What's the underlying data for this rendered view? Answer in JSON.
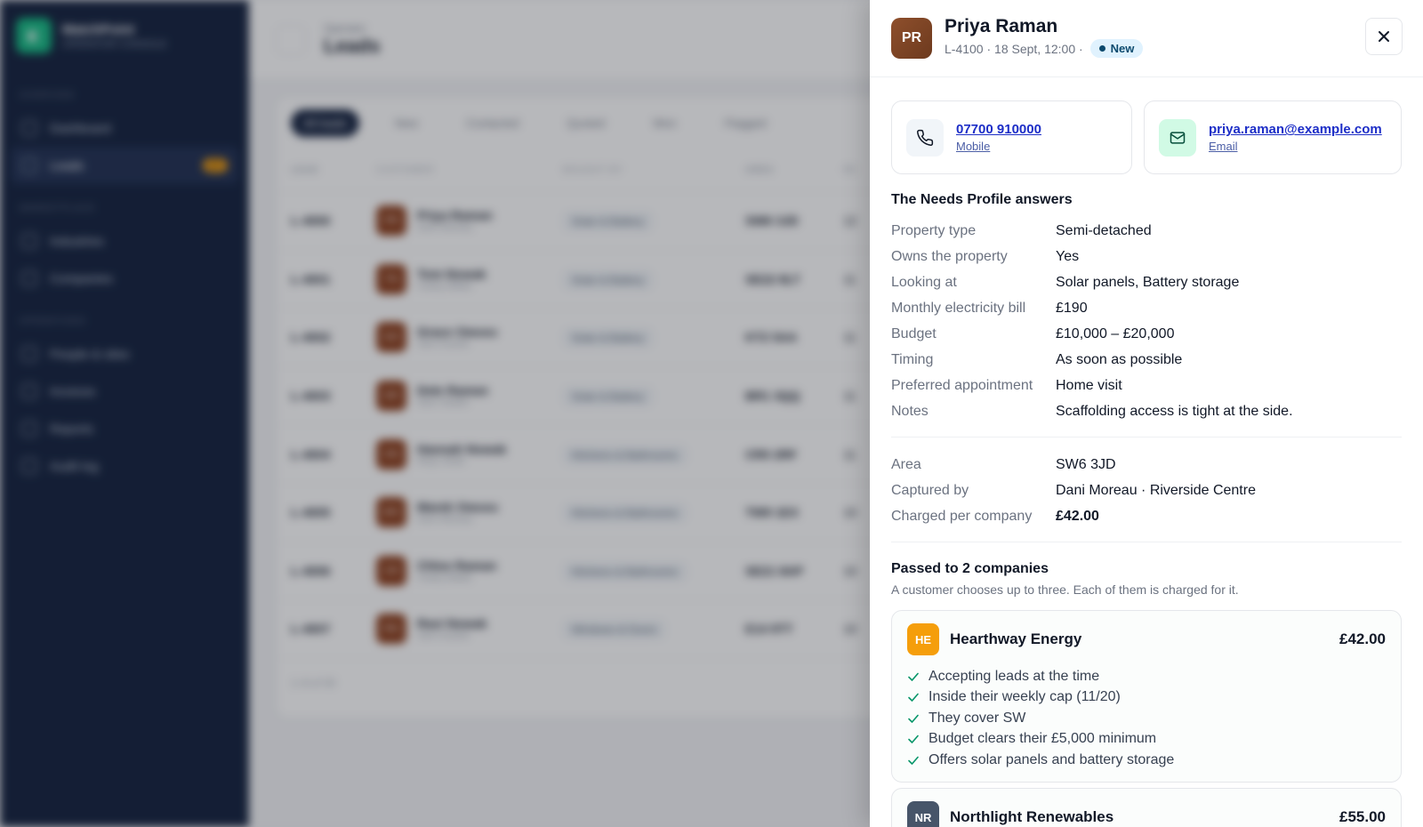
{
  "app": {
    "brand_name": "MatchPoint",
    "brand_sub": "OPERATOR CONSOLE",
    "nav": [
      {
        "section": "OVERVIEW"
      },
      {
        "label": "Dashboard"
      },
      {
        "label": "Leads",
        "badge": "27",
        "active": true
      },
      {
        "section": "MARKETPLACE"
      },
      {
        "label": "Industries"
      },
      {
        "label": "Companies"
      },
      {
        "section": "OPERATIONS"
      },
      {
        "label": "People & sites"
      },
      {
        "label": "Invoices"
      },
      {
        "label": "Reports"
      },
      {
        "label": "Audit log"
      }
    ],
    "breadcrumb": "Operator",
    "page_title": "Leads",
    "filters": [
      "All leads",
      "New",
      "Contacted",
      "Quoted",
      "Won",
      "Flagged"
    ],
    "table_headers": [
      "LEAD",
      "CUSTOMER",
      "BOUGHT BY",
      "AREA",
      "RE"
    ],
    "rows": [
      {
        "id": "L-4000",
        "initials": "PR",
        "name": "Priya Raman",
        "sub": "Dani Moreau",
        "tag": "Solar & Battery",
        "area": "SW6 3JD",
        "extra": "12"
      },
      {
        "id": "L-4001",
        "initials": "TN",
        "name": "Tom Nowak",
        "sub": "Casey Blake",
        "tag": "Solar & Battery",
        "area": "SE22 8LT",
        "extra": "11"
      },
      {
        "id": "L-4002",
        "initials": "GO",
        "name": "Grace Owusu",
        "sub": "Sam Duarte",
        "tag": "Solar & Battery",
        "area": "KT2 5AA",
        "extra": "11"
      },
      {
        "id": "L-4003",
        "initials": "DR",
        "name": "Dele Raman",
        "sub": "Sam Okafor",
        "tag": "Solar & Battery",
        "area": "BR1 3QQ",
        "extra": "11"
      },
      {
        "id": "L-4004",
        "initials": "HN",
        "name": "Hannah Nowak",
        "sub": "Rhys Shah",
        "tag": "Kitchens & Bathrooms",
        "area": "CR0 2RF",
        "extra": "11"
      },
      {
        "id": "L-4005",
        "initials": "MO",
        "name": "Marek Owusu",
        "sub": "Dani Moreau",
        "tag": "Kitchens & Bathrooms",
        "area": "TW9 1EX",
        "extra": "10"
      },
      {
        "id": "L-4006",
        "initials": "CR",
        "name": "Chloe Raman",
        "sub": "Casey Blake",
        "tag": "Kitchens & Bathrooms",
        "area": "SE21 8AP",
        "extra": "10"
      },
      {
        "id": "L-4007",
        "initials": "RN",
        "name": "Ravi Nowak",
        "sub": "Sam Duarte",
        "tag": "Windows & Doors",
        "area": "E14 9TT",
        "extra": "10"
      }
    ],
    "count_text": "1–8 of 30"
  },
  "drawer": {
    "avatar_initials": "PR",
    "name": "Priya Raman",
    "meta": "L-4100 · 18 Sept, 12:00 ·",
    "status": "New",
    "phone": {
      "value": "07700 910000",
      "label": "Mobile"
    },
    "email": {
      "value": "priya.raman@example.com",
      "label": "Email"
    },
    "needs_title": "The Needs Profile answers",
    "needs": [
      {
        "k": "Property type",
        "v": "Semi-detached"
      },
      {
        "k": "Owns the property",
        "v": "Yes"
      },
      {
        "k": "Looking at",
        "v": "Solar panels, Battery storage"
      },
      {
        "k": "Monthly electricity bill",
        "v": "£190"
      },
      {
        "k": "Budget",
        "v": "£10,000 – £20,000"
      },
      {
        "k": "Timing",
        "v": "As soon as possible"
      },
      {
        "k": "Preferred appointment",
        "v": "Home visit"
      },
      {
        "k": "Notes",
        "v": "Scaffolding access is tight at the side."
      }
    ],
    "details": [
      {
        "k": "Area",
        "v": "SW6 3JD"
      },
      {
        "k": "Captured by",
        "v": "Dani Moreau · Riverside Centre"
      },
      {
        "k": "Charged per company",
        "v": "£42.00"
      }
    ],
    "passed_title": "Passed to 2 companies",
    "passed_sub": "A customer chooses up to three. Each of them is charged for it.",
    "companies": [
      {
        "initials": "HE",
        "name": "Hearthway Energy",
        "price": "£42.00",
        "color": "#f59e0b",
        "checks": [
          "Accepting leads at the time",
          "Inside their weekly cap (11/20)",
          "They cover SW",
          "Budget clears their £5,000 minimum",
          "Offers solar panels and battery storage"
        ]
      },
      {
        "initials": "NR",
        "name": "Northlight Renewables",
        "price": "£55.00",
        "color": "#475569",
        "checks": []
      }
    ]
  }
}
